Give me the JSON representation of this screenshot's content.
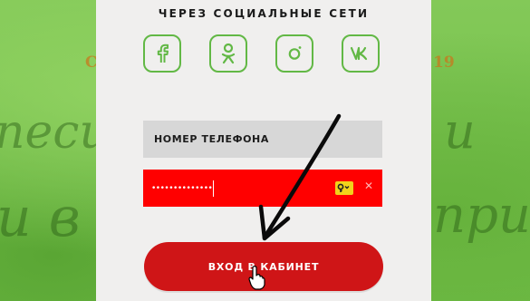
{
  "social": {
    "title": "ЧЕРЕЗ СОЦИАЛЬНЫЕ СЕТИ",
    "icons": [
      "facebook-icon",
      "odnoklassniki-icon",
      "instagram-icon",
      "vk-icon"
    ]
  },
  "background": {
    "left_number": "С",
    "right_number": "19",
    "script_left_1": "песи",
    "script_left_2": "и в",
    "script_right_1": "и",
    "script_right_2": "при"
  },
  "form": {
    "phone_placeholder": "НОМЕР ТЕЛЕФОНА",
    "password_value": "••••••••••••••"
  },
  "login_button": {
    "label": "ВХОД В КАБИНЕТ"
  },
  "colors": {
    "accent_green": "#62b845",
    "error_red": "#ff0000",
    "button_red": "#cf1517",
    "panel_bg": "#f0efee"
  }
}
